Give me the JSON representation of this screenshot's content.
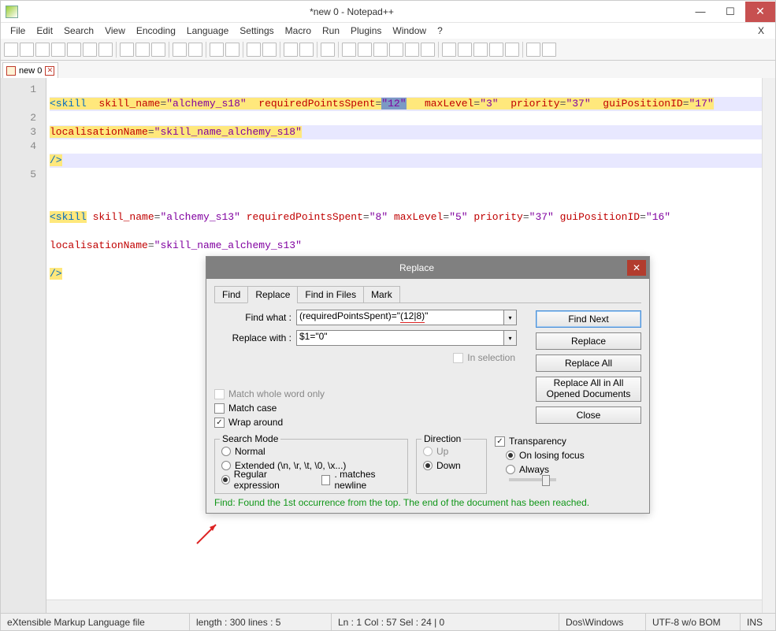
{
  "titlebar": {
    "title": "*new  0 - Notepad++"
  },
  "menu": {
    "items": [
      "File",
      "Edit",
      "Search",
      "View",
      "Encoding",
      "Language",
      "Settings",
      "Macro",
      "Run",
      "Plugins",
      "Window",
      "?"
    ],
    "right": "X"
  },
  "filetab": {
    "name": "new  0"
  },
  "gutter": [
    "1",
    "2",
    "3",
    "4",
    "5"
  ],
  "code": {
    "l1": {
      "tag_open": "<skill",
      "sp1": "  ",
      "a1n": "skill_name",
      "eq": "=",
      "a1v": "\"alchemy_s18\"",
      "sp2": "  ",
      "a2n": "requiredPointsSpent",
      "a2v": "\"12\"",
      "sp3": "   ",
      "a3n": "maxLevel",
      "a3v": "\"3\"",
      "sp4": "  ",
      "a4n": "priority",
      "a4v": "\"37\"",
      "sp5": "  ",
      "a5n": "guiPositionID",
      "a5v": "\"17\"",
      "br_a6n": "localisationName",
      "br_a6v": "\"skill_name_alchemy_s18\""
    },
    "l2": {
      "close": "/>"
    },
    "l3": "",
    "l4": {
      "tag_open": "<skill",
      "a1n": "skill_name",
      "a1v": "\"alchemy_s13\"",
      "a2n": "requiredPointsSpent",
      "a2v": "\"8\"",
      "a3n": "maxLevel",
      "a3v": "\"5\"",
      "a4n": "priority",
      "a4v": "\"37\"",
      "a5n": "guiPositionID",
      "a5v": "\"16\"",
      "br_a6n": "localisationName",
      "br_a6v": "\"skill_name_alchemy_s13\""
    },
    "l5": {
      "close": "/>"
    }
  },
  "dialog": {
    "title": "Replace",
    "tabs": [
      "Find",
      "Replace",
      "Find in Files",
      "Mark"
    ],
    "active_tab": 1,
    "find_label": "Find what :",
    "find_value_pre": "(requiredPointsSpent)=\"",
    "find_value_mark": "(12|8)",
    "find_value_post": "\"",
    "replace_label": "Replace with :",
    "replace_value": "$1=\"0\"",
    "in_selection": "In selection",
    "btn_find_next": "Find Next",
    "btn_replace": "Replace",
    "btn_replace_all": "Replace All",
    "btn_replace_all_docs": "Replace All in All Opened Documents",
    "btn_close": "Close",
    "chk_whole_word": "Match whole word only",
    "chk_match_case": "Match case",
    "chk_wrap": "Wrap around",
    "grp_search_mode": "Search Mode",
    "rb_normal": "Normal",
    "rb_extended": "Extended (\\n, \\r, \\t, \\0, \\x...)",
    "rb_regex": "Regular expression",
    "chk_dot_newline": ". matches newline",
    "grp_direction": "Direction",
    "rb_up": "Up",
    "rb_down": "Down",
    "chk_transparency": "Transparency",
    "rb_on_losing": "On losing focus",
    "rb_always": "Always",
    "status": "Find: Found the 1st occurrence from the top. The end of the document has been reached."
  },
  "status": {
    "lang": "eXtensible Markup Language file",
    "length": "length : 300    lines : 5",
    "pos": "Ln : 1    Col : 57    Sel : 24 | 0",
    "eol": "Dos\\Windows",
    "enc": "UTF-8 w/o BOM",
    "mode": "INS"
  }
}
